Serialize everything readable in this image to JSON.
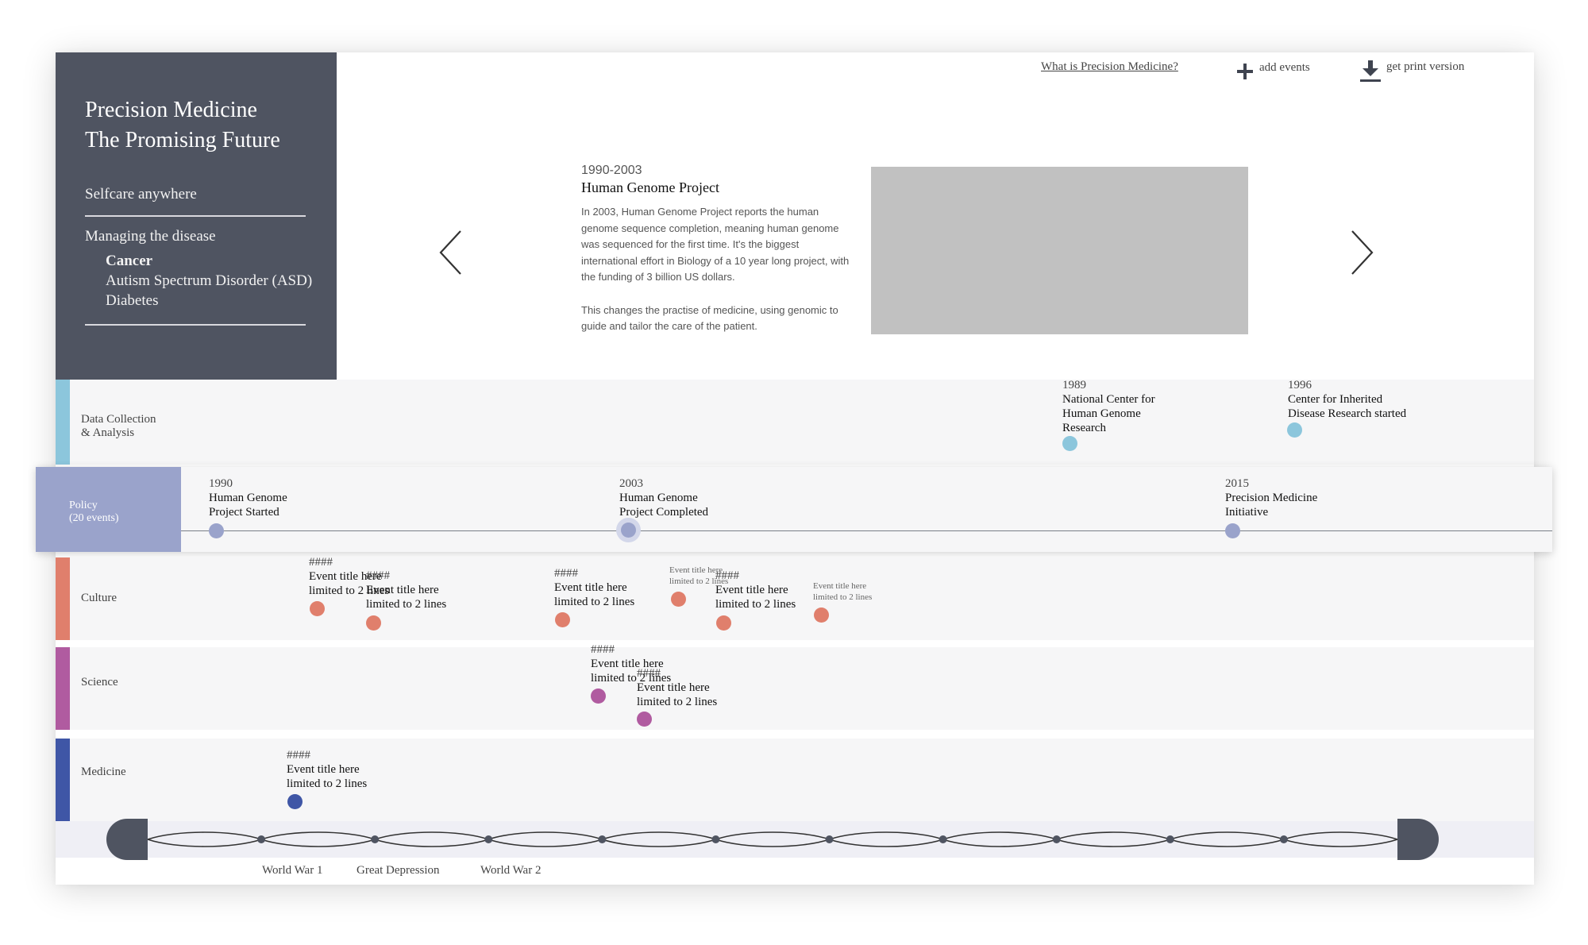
{
  "sidebar": {
    "title_line1": "Precision Medicine",
    "title_line2": "The Promising Future",
    "selfcare": "Selfcare anywhere",
    "managing": "Managing the disease",
    "diseases": [
      "Cancer",
      "Autism Spectrum Disorder (ASD)",
      "Diabetes"
    ]
  },
  "toplinks": {
    "what_is": "What is Precision Medicine?",
    "add_events": "add events",
    "print": "get print version"
  },
  "featured": {
    "years": "1990-2003",
    "title": "Human Genome Project",
    "para1": "In 2003, Human Genome Project reports the human genome sequence completion, meaning human genome was sequenced for the first time. It's the biggest  international effort in Biology of a 10 year long project, with the funding of 3 billion US dollars.",
    "para2": "This changes the practise of medicine, using genomic to guide and tailor the care of the patient."
  },
  "tracks": {
    "data": {
      "label_line1": "Data Collection",
      "label_line2": "& Analysis",
      "color": "#8cc6dc",
      "events": [
        {
          "year": "1989",
          "line1": "National Center for",
          "line2": "Human Genome",
          "line3": "Research"
        },
        {
          "year": "1996",
          "line1": "Center for Inherited",
          "line2": "Disease Research started"
        }
      ]
    },
    "policy": {
      "label_line1": "Policy",
      "label_line2": "(20 events)",
      "color": "#9aa3cb",
      "events": [
        {
          "year": "1990",
          "line1": "Human Genome",
          "line2": "Project Started"
        },
        {
          "year": "2003",
          "line1": "Human Genome",
          "line2": "Project Completed"
        },
        {
          "year": "2015",
          "line1": "Precision Medicine",
          "line2": "Initiative"
        }
      ]
    },
    "culture": {
      "label": "Culture",
      "color": "#e07f6c",
      "events": [
        {
          "year": "####",
          "line1": "Event title here",
          "line2": "limited to 2 lines"
        },
        {
          "year": "####",
          "line1": "Event title here",
          "line2": "limited to 2 lines"
        },
        {
          "year": "####",
          "line1": "Event title here",
          "line2": "limited to 2 lines"
        },
        {
          "year": "",
          "line1": "Event title here",
          "line2": "limited to 2 lines"
        },
        {
          "year": "####",
          "line1": "Event title here",
          "line2": "limited to 2 lines"
        },
        {
          "year": "",
          "line1": "Event title here",
          "line2": "limited to 2 lines"
        }
      ]
    },
    "science": {
      "label": "Science",
      "color": "#b05ba0",
      "events": [
        {
          "year": "####",
          "line1": "Event title here",
          "line2": "limited to 2 lines"
        },
        {
          "year": "####",
          "line1": "Event title here",
          "line2": "limited to 2 lines"
        }
      ]
    },
    "medicine": {
      "label": "Medicine",
      "color": "#3f56a6",
      "events": [
        {
          "year": "####",
          "line1": "Event title here",
          "line2": "limited to 2 lines"
        }
      ]
    }
  },
  "eras": [
    "World War 1",
    "Great Depression",
    "World War 2"
  ],
  "colors": {
    "sidebar_bg": "#4f5461",
    "placeholder": "#c1c1c1",
    "timeline_handle": "#4f5461"
  },
  "icons": {
    "prev": "chevron-left-icon",
    "next": "chevron-right-icon",
    "add": "plus-icon",
    "download": "download-icon"
  }
}
